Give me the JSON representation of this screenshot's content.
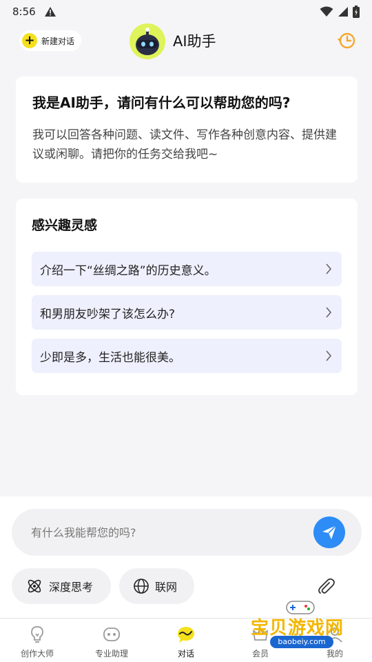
{
  "status_bar": {
    "time": "8:56"
  },
  "header": {
    "new_chat_label": "新建对话",
    "title": "AI助手"
  },
  "intro": {
    "heading": "我是AI助手，请问有什么可以帮助您的吗?",
    "body": "我可以回答各种问题、读文件、写作各种创意内容、提供建议或闲聊。请把你的任务交给我吧~"
  },
  "inspiration": {
    "heading": "感兴趣灵感",
    "items": [
      {
        "label": "介绍一下“丝绸之路”的历史意义。"
      },
      {
        "label": "和男朋友吵架了该怎么办?"
      },
      {
        "label": "少即是多，生活也能很美。"
      }
    ]
  },
  "composer": {
    "placeholder": "有什么我能帮您的吗?",
    "value": "",
    "deep_think_label": "深度思考",
    "web_label": "联网"
  },
  "tabs": [
    {
      "label": "创作大师",
      "icon": "lightbulb-icon",
      "active": false
    },
    {
      "label": "专业助理",
      "icon": "robot-icon",
      "active": false
    },
    {
      "label": "对话",
      "icon": "chat-icon",
      "active": true
    },
    {
      "label": "会员",
      "icon": "member-icon",
      "active": false
    },
    {
      "label": "我的",
      "icon": "profile-icon",
      "active": false
    }
  ],
  "watermark": {
    "text": "宝贝游戏网",
    "sub": "baobeiy.com"
  },
  "colors": {
    "accent_yellow": "#f5e01c",
    "send_blue": "#2d8cf6",
    "suggestion_bg": "#eef0fd",
    "history_orange": "#f4a62a"
  }
}
